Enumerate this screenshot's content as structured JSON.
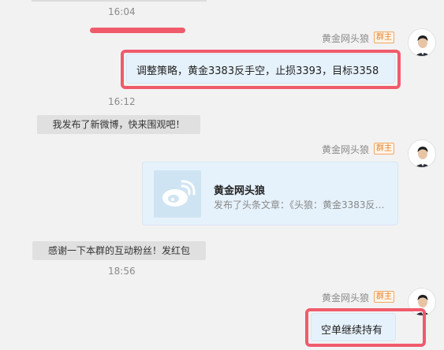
{
  "messages": {
    "time1": "16:04",
    "time2": "16:12",
    "time3": "18:56",
    "sender_name": "黄金网头狼",
    "badge": "群主",
    "msg_text1": "调整策略，黄金3383反手空，止损3393，目标3358",
    "notice1": "我发布了新微博，快来围观吧！",
    "card_title": "黄金网头狼",
    "card_desc": "发布了头条文章：《头狼：黄金3383反…",
    "notice2": "感谢一下本群的互动粉丝！发红包",
    "msg_text2": "空单继续持有"
  },
  "colors": {
    "highlight": "#f05b6c",
    "bubble": "#e6f2fb",
    "badge_border": "#f0a860"
  },
  "icons": {
    "avatar": "avatar-icon",
    "weibo": "weibo-icon"
  }
}
